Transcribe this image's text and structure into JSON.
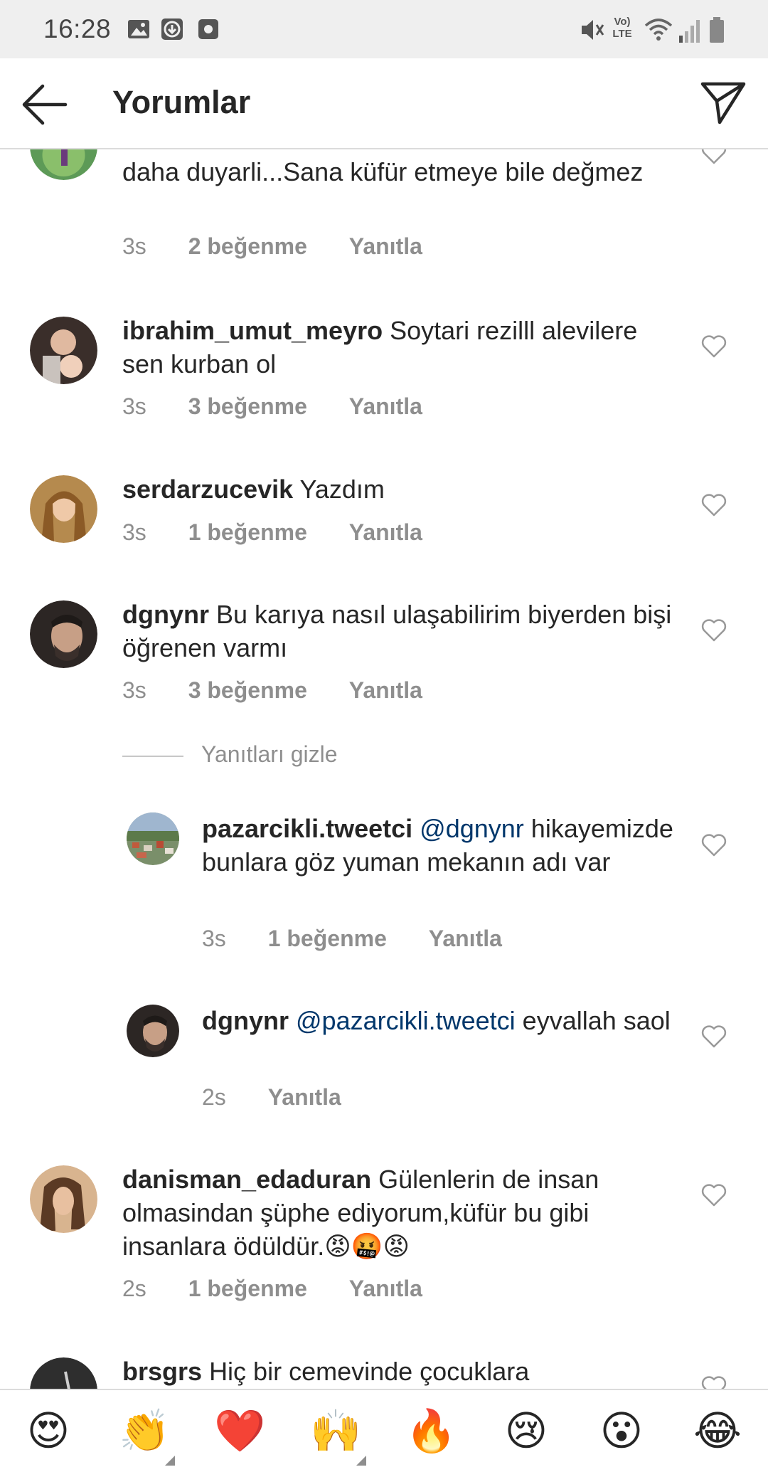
{
  "status_bar": {
    "time": "16:28",
    "left_icons": [
      "image-icon",
      "download-icon",
      "app-icon"
    ],
    "right_icons": [
      "mute-icon",
      "volte-icon",
      "wifi-icon",
      "signal-icon",
      "battery-icon"
    ],
    "volte_line1": "Vo)",
    "volte_line2": "LTE"
  },
  "header": {
    "title": "Yorumlar",
    "back_icon": "arrow-left-icon",
    "send_icon": "paper-plane-icon"
  },
  "comments": [
    {
      "username": "",
      "text": "daha duyarli...Sana küfür etmeye bile değmez",
      "time": "3s",
      "likes": "2 beğenme",
      "reply": "Yanıtla"
    },
    {
      "username": "ibrahim_umut_meyro",
      "text": "Soytari rezilll alevilere sen kurban ol",
      "time": "3s",
      "likes": "3 beğenme",
      "reply": "Yanıtla"
    },
    {
      "username": "serdarzucevik",
      "text": "Yazdım",
      "time": "3s",
      "likes": "1 beğenme",
      "reply": "Yanıtla"
    },
    {
      "username": "dgnynr",
      "text": "Bu karıya nasıl ulaşabilirim biyerden bişi öğrenen varmı",
      "time": "3s",
      "likes": "3 beğenme",
      "reply": "Yanıtla"
    },
    {
      "username": "danisman_edaduran",
      "text": "Gülenlerin de insan olmasindan şüphe  ediyorum,küfür bu gibi insanlara ödüldür.",
      "emoji": "😡🤬😡",
      "time": "2s",
      "likes": "1 beğenme",
      "reply": "Yanıtla"
    },
    {
      "username": "brsgrs",
      "text": "Hiç bir cemevinde çocuklara"
    }
  ],
  "hide_replies_label": "Yanıtları gizle",
  "replies": [
    {
      "username": "pazarcikli.tweetci",
      "mention": "@dgnynr",
      "text": "hikayemizde bunlara göz yuman mekanın adı var",
      "time": "3s",
      "likes": "1 beğenme",
      "reply": "Yanıtla"
    },
    {
      "username": "dgnynr",
      "mention": "@pazarcikli.tweetci",
      "text": "eyvallah saol",
      "time": "2s",
      "reply": "Yanıtla"
    }
  ],
  "emoji_bar": [
    "😍",
    "👏",
    "❤️",
    "🙌",
    "🔥",
    "😢",
    "😮",
    "😂"
  ],
  "colors": {
    "text": "#262626",
    "meta": "#8e8e8e",
    "mention": "#00376b",
    "heart_red": "#ed4956",
    "statusbar_bg": "#efefef"
  }
}
